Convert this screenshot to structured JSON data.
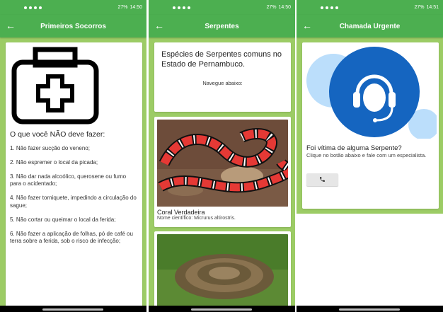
{
  "status": {
    "s1": {
      "battery": "27%",
      "time": "14:50"
    },
    "s2": {
      "battery": "27%",
      "time": "14:50"
    },
    "s3": {
      "battery": "27%",
      "time": "14:51"
    }
  },
  "screen1": {
    "title": "Primeiros Socorros",
    "heading": "O que você NÃO deve fazer:",
    "items": [
      "1. Não fazer sucção do veneno;",
      "2. Não espremer o local da picada;",
      "3. Não dar nada alcoólico, querosene ou fumo para o acidentado;",
      "4. Não fazer torniquete, impedindo a circulação do sague;",
      "5. Não cortar ou queimar o local da ferida;",
      "6. Não fazer a aplicação de folhas, pó de café ou terra sobre a ferida, sob o risco de infecção;"
    ]
  },
  "screen2": {
    "title": "Serpentes",
    "heading": "Espécies de Serpentes comuns no Estado de Pernambuco.",
    "subtitle": "Navegue abaixo:",
    "snakes": [
      {
        "name": "Coral Verdadeira",
        "scientific": "Nome científico: Micrurus altirostris."
      }
    ]
  },
  "screen3": {
    "title": "Chamada Urgente",
    "heading": "Foi vítima de alguma Serpente?",
    "text": "Clique no botão abaixo e fale com um especialista."
  },
  "colors": {
    "primary": "#4caf50",
    "background": "#9ccc65",
    "support_blue": "#1565c0"
  },
  "icons": {
    "back": "arrow-left-icon",
    "firstaid": "first-aid-kit-icon",
    "support": "headset-support-icon",
    "phone": "phone-icon"
  }
}
